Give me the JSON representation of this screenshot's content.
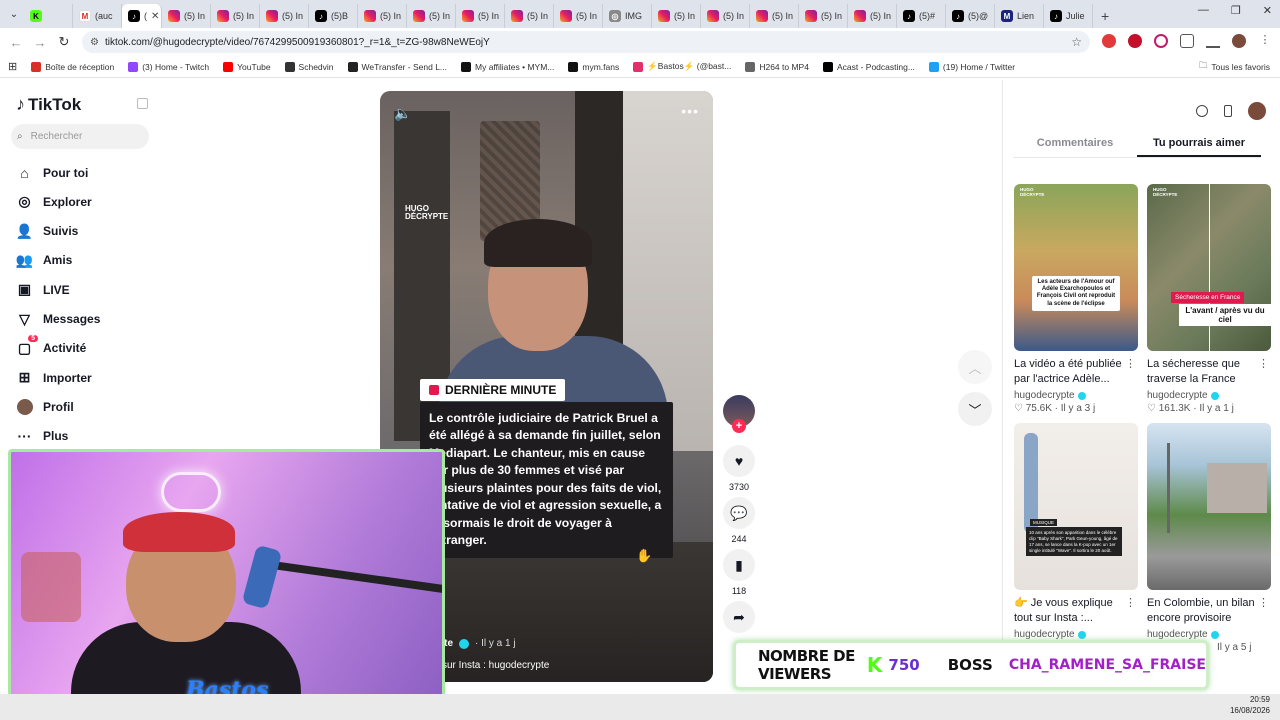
{
  "browser": {
    "tabs": [
      {
        "icon": "kick-icon",
        "label": ""
      },
      {
        "icon": "gmail-icon",
        "label": "(auc"
      },
      {
        "icon": "tiktok-icon",
        "label": "(",
        "active": true
      },
      {
        "icon": "instagram-icon",
        "label": "(5) In"
      },
      {
        "icon": "instagram-icon",
        "label": "(5) In"
      },
      {
        "icon": "instagram-icon",
        "label": "(5) In"
      },
      {
        "icon": "tiktok-icon",
        "label": "(5)B"
      },
      {
        "icon": "instagram-icon",
        "label": "(5) In"
      },
      {
        "icon": "instagram-icon",
        "label": "(5) In"
      },
      {
        "icon": "instagram-icon",
        "label": "(5) In"
      },
      {
        "icon": "instagram-icon",
        "label": "(5) In"
      },
      {
        "icon": "instagram-icon",
        "label": "(5) In"
      },
      {
        "icon": "globe-icon",
        "label": "IMG"
      },
      {
        "icon": "instagram-icon",
        "label": "(5) In"
      },
      {
        "icon": "instagram-icon",
        "label": "(5) In"
      },
      {
        "icon": "instagram-icon",
        "label": "(5) In"
      },
      {
        "icon": "instagram-icon",
        "label": "(5) In"
      },
      {
        "icon": "instagram-icon",
        "label": "(5) In"
      },
      {
        "icon": "tiktok-icon",
        "label": "(5)#"
      },
      {
        "icon": "tiktok-icon",
        "label": "(5)@"
      },
      {
        "icon": "lemonde-icon",
        "label": "Lien"
      },
      {
        "icon": "tiktok-icon",
        "label": "Julie"
      }
    ],
    "url": "tiktok.com/@hugodecrypte/video/7674299500919360801?_r=1&_t=ZG-98w8NeWEojY",
    "bookmarks": [
      {
        "icon": "gmail-icon",
        "label": "Boîte de réception"
      },
      {
        "icon": "twitch-icon",
        "label": "(3) Home - Twitch"
      },
      {
        "icon": "youtube-icon",
        "label": "YouTube"
      },
      {
        "icon": "dash-icon",
        "label": "Schedvin"
      },
      {
        "icon": "wetransfer-icon",
        "label": "WeTransfer - Send L..."
      },
      {
        "icon": "myaffiliates-icon",
        "label": "My affiliates • MYM..."
      },
      {
        "icon": "mym-icon",
        "label": "mym.fans"
      },
      {
        "icon": "instagram-icon",
        "label": "⚡Bastos⚡ (@bast..."
      },
      {
        "icon": "link-icon",
        "label": "H264 to MP4"
      },
      {
        "icon": "acast-icon",
        "label": "Acast - Podcasting..."
      },
      {
        "icon": "twitter-icon",
        "label": "(19) Home / Twitter"
      }
    ],
    "all_bookmarks": "Tous les favoris"
  },
  "tiktok": {
    "logo": "TikTok",
    "search_placeholder": "Rechercher",
    "nav": [
      {
        "icon": "home-icon",
        "label": "Pour toi"
      },
      {
        "icon": "compass-icon",
        "label": "Explorer"
      },
      {
        "icon": "following-icon",
        "label": "Suivis"
      },
      {
        "icon": "friends-icon",
        "label": "Amis"
      },
      {
        "icon": "live-icon",
        "label": "LIVE"
      },
      {
        "icon": "messages-icon",
        "label": "Messages"
      },
      {
        "icon": "activity-icon",
        "label": "Activité",
        "badge": "5"
      },
      {
        "icon": "upload-icon",
        "label": "Importer"
      },
      {
        "icon": "avatar",
        "label": "Profil"
      },
      {
        "icon": "more-icon",
        "label": "Plus"
      }
    ],
    "video": {
      "watermark": "HUGO\nDÉCRYPTE",
      "tag": "DERNIÈRE MINUTE",
      "text": "Le contrôle judiciaire de Patrick Bruel a été allégé à sa demande fin juillet, selon Mediapart. Le chanteur, mis en cause par plus de 30 femmes et visé par plusieurs plaintes pour des faits de viol, tentative de viol et agression sexuelle, a désormais le droit de voyager à l'étranger.",
      "author": "pte",
      "time": "· Il y a 1 j",
      "desc": "sur Insta : hugodecrypte"
    },
    "actions": {
      "likes": "3730",
      "comments": "244",
      "saves": "118"
    },
    "right_panel": {
      "tabs": [
        "Commentaires",
        "Tu pourrais aimer"
      ],
      "active_tab": 1,
      "cards": [
        {
          "title": "La vidéo a été publiée par l'actrice Adèle...",
          "author": "hugodecrypte",
          "views": "75.6K",
          "time": "Il y a 3 j",
          "caption": "Les acteurs de l'Amour ouf Adèle Exarchopoulos et François Civil ont reproduit la scène de l'éclipse"
        },
        {
          "title": "La sécheresse que traverse la France cet...",
          "author": "hugodecrypte",
          "views": "161.3K",
          "time": "Il y a 1 j",
          "caption_red": "Sécheresse en France",
          "caption": "L'avant / après vu du ciel"
        },
        {
          "title": "👉 Je vous explique tout sur Insta :...",
          "author": "hugodecrypte",
          "views": "",
          "time": "",
          "caption_mini": "MUSIQUE",
          "caption": "10 ans après son apparition dans le célèbre clip \"Baby Shark\", Park Geun-young, âgé de 17 ans, se lance dans la K-pop avec un 1er single intitulé \"Wave\". Il sortira le 20 août."
        },
        {
          "title": "En Colombie, un bilan encore provisoire fait...",
          "author": "hugodecrypte",
          "views": "",
          "time": "Il y a 5 j",
          "caption": ""
        }
      ]
    }
  },
  "overlay": {
    "viewers_label": "NOMBRE DE VIEWERS",
    "viewers_count": "750",
    "boss_label": "BOSS",
    "boss_user": "CHA_RAMENE_SA_FRAISE",
    "cam_logo": "Bastos"
  },
  "taskbar": {
    "time": "20:59",
    "date": "16/08/2026"
  }
}
